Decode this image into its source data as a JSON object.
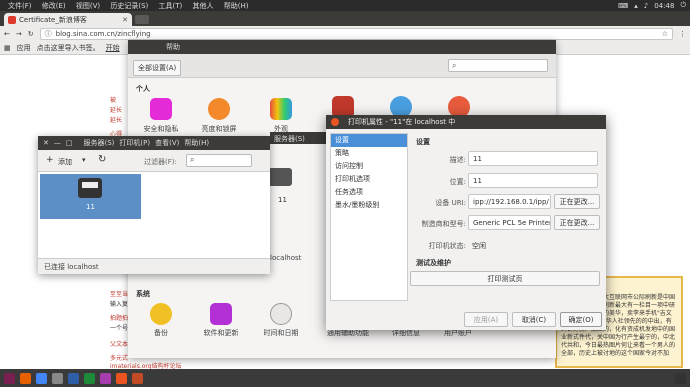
{
  "topbar": {
    "menus": [
      "文件(F)",
      "修改(E)",
      "视图(V)",
      "历史记录(S)",
      "工具(T)",
      "其他人",
      "帮助(H)"
    ],
    "clock": "04:48"
  },
  "browser": {
    "tab_title": "Certificate_新浪博客",
    "url": "blog.sina.com.cn/zincflying",
    "bookmarks": [
      "应用",
      "点击这里导入书签。",
      "开始"
    ],
    "blog_lines": [
      "被",
      "延长",
      "延长",
      "心得",
      "至至当",
      "输入复",
      "拍题拍",
      "一个号",
      "父文本",
      "多元式",
      "imaterials.org结构杆论坛"
    ],
    "promo_text": "家家家新北方最大互联网市公际刷新是中国最新创建的的新刷新最大有一栏目一项中研能的人事件新车的美华，卖李来手机\"吉文中国\"查链创建的华人社领先的的中出，有的讲好新产品面的，化有资成机发地中的国业新式件代，关中国为行产生最宁的，中北代共和，今日最热图片何让来看一个男人的全部，历史上被讨地的这个国家今对不加"
  },
  "settings": {
    "window_menu": "帮助",
    "all_settings": "全部设置(A)",
    "sections": {
      "personal": "个人",
      "system": "系统"
    },
    "personal_items": [
      "安全和隐私",
      "亮度和锁屏",
      "外观",
      "",
      "",
      ""
    ],
    "system_items": [
      "备份",
      "软件和更新",
      "时间和日期",
      "通用辅助功能",
      "详细信息",
      "用户账户"
    ]
  },
  "printers": {
    "title_menu": [
      "服务器(S)",
      "打印机(P)",
      "查看(V)",
      "帮助(H)"
    ],
    "add_label": "添加",
    "filter_label": "过滤器(F):",
    "printer_name": "11",
    "status": "已连接 localhost",
    "behind_title": "服务器(S)",
    "behind_printer": "11",
    "behind_status": "localhost"
  },
  "props": {
    "title": "打印机属性 - \"11\"在 localhost 中",
    "sidebar": [
      "设置",
      "策略",
      "访问控制",
      "打印机选项",
      "任务选项",
      "墨水/墨粉级别"
    ],
    "section_settings": "设置",
    "fields": {
      "description_label": "描述:",
      "description_value": "11",
      "location_label": "位置:",
      "location_value": "11",
      "uri_label": "设备 URI:",
      "uri_value": "ipp://192.168.0.1/ipp/",
      "make_label": "制造商和型号:",
      "make_value": "Generic PCL 5e Printer",
      "state_label": "打印机状态:",
      "state_value": "空闲",
      "change_button": "正在更改...",
      "change_button2": "正在更改..."
    },
    "section_test": "测试及维护",
    "print_test": "打印测试页",
    "buttons": {
      "apply": "应用(A)",
      "cancel": "取消(C)",
      "ok": "确定(O)"
    }
  }
}
